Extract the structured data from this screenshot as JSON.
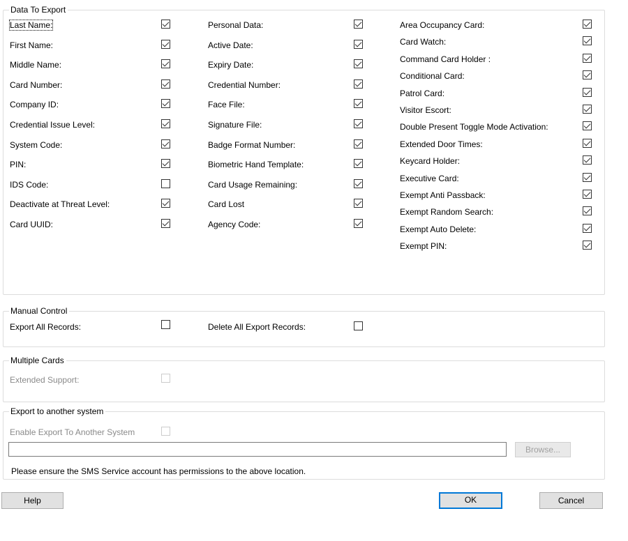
{
  "data_to_export": {
    "title": "Data To Export",
    "col1": [
      {
        "label": "Last Name:",
        "checked": true
      },
      {
        "label": "First Name:",
        "checked": true
      },
      {
        "label": "Middle Name:",
        "checked": true
      },
      {
        "label": "Card Number:",
        "checked": true
      },
      {
        "label": "Company ID:",
        "checked": true
      },
      {
        "label": "Credential Issue Level:",
        "checked": true
      },
      {
        "label": "System Code:",
        "checked": true
      },
      {
        "label": "PIN:",
        "checked": true
      },
      {
        "label": "IDS Code:",
        "checked": false
      },
      {
        "label": "Deactivate at Threat Level:",
        "checked": true
      },
      {
        "label": "Card UUID:",
        "checked": true
      }
    ],
    "col2": [
      {
        "label": "Personal Data:",
        "checked": true
      },
      {
        "label": "Active Date:",
        "checked": true
      },
      {
        "label": "Expiry Date:",
        "checked": true
      },
      {
        "label": "Credential Number:",
        "checked": true
      },
      {
        "label": "Face File:",
        "checked": true
      },
      {
        "label": "Signature File:",
        "checked": true
      },
      {
        "label": "Badge Format Number:",
        "checked": true
      },
      {
        "label": "Biometric Hand Template:",
        "checked": true
      },
      {
        "label": "Card Usage Remaining:",
        "checked": true
      },
      {
        "label": "Card Lost",
        "checked": true
      },
      {
        "label": "Agency Code:",
        "checked": true
      }
    ],
    "col3": [
      {
        "label": "Area Occupancy Card:",
        "checked": true
      },
      {
        "label": "Card Watch:",
        "checked": true
      },
      {
        "label": "Command Card Holder :",
        "checked": true
      },
      {
        "label": "Conditional Card:",
        "checked": true
      },
      {
        "label": "Patrol Card:",
        "checked": true
      },
      {
        "label": "Visitor Escort:",
        "checked": true
      },
      {
        "label": "Double Present Toggle Mode Activation:",
        "checked": true
      },
      {
        "label": "Extended Door Times:",
        "checked": true
      },
      {
        "label": "Keycard Holder:",
        "checked": true
      },
      {
        "label": "Executive Card:",
        "checked": true
      },
      {
        "label": "Exempt Anti Passback:",
        "checked": true
      },
      {
        "label": "Exempt Random Search:",
        "checked": true
      },
      {
        "label": "Exempt Auto Delete:",
        "checked": true
      },
      {
        "label": "Exempt PIN:",
        "checked": true
      }
    ]
  },
  "manual_control": {
    "title": "Manual Control",
    "export_all_label": "Export All Records:",
    "export_all_checked": false,
    "delete_all_label": "Delete All Export Records:",
    "delete_all_checked": false
  },
  "multiple_cards": {
    "title": "Multiple Cards",
    "extended_support_label": "Extended Support:",
    "extended_support_checked": false
  },
  "export_other": {
    "title": "Export to another system",
    "enable_label": "Enable Export To Another System",
    "enable_checked": false,
    "path_value": "",
    "browse_label": "Browse...",
    "note": "Please ensure the SMS Service account has permissions to the above location."
  },
  "buttons": {
    "help": "Help",
    "ok": "OK",
    "cancel": "Cancel"
  }
}
